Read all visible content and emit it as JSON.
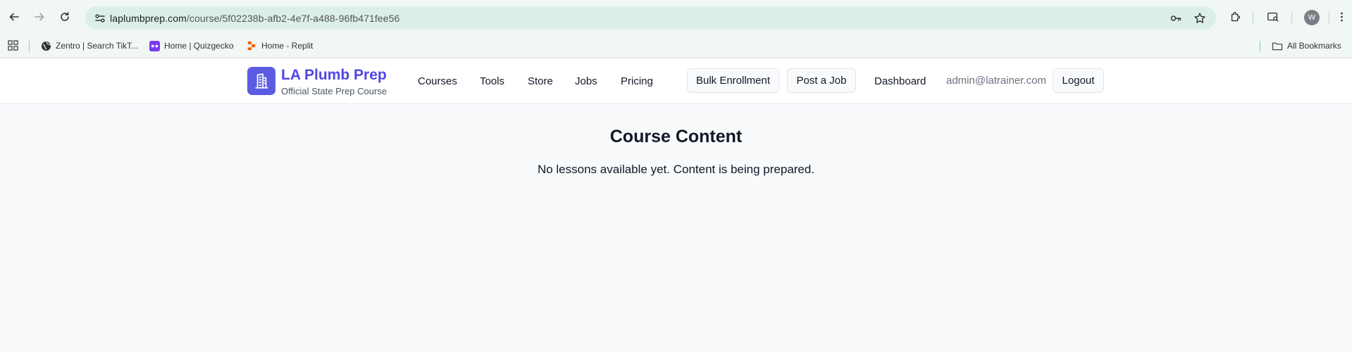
{
  "browser": {
    "url_domain": "laplumbprep.com",
    "url_path": "/course/5f02238b-afb2-4e7f-a488-96fb471fee56",
    "profile_initial": "W",
    "bookmarks": [
      {
        "label": "Zentro | Search TikT...",
        "icon": "globe-icon"
      },
      {
        "label": "Home | Quizgecko",
        "icon": "quizgecko-icon"
      },
      {
        "label": "Home - Replit",
        "icon": "replit-icon"
      }
    ],
    "all_bookmarks_label": "All Bookmarks"
  },
  "site": {
    "brand": "LA Plumb Prep",
    "tagline": "Official State Prep Course",
    "nav": [
      "Courses",
      "Tools",
      "Store",
      "Jobs",
      "Pricing"
    ],
    "bulk_enrollment": "Bulk Enrollment",
    "post_job": "Post a Job",
    "dashboard": "Dashboard",
    "email": "admin@latrainer.com",
    "logout": "Logout"
  },
  "main": {
    "title": "Course Content",
    "message": "No lessons available yet. Content is being prepared."
  },
  "colors": {
    "brand": "#4f46e5",
    "logo_bg": "#5b5ce2",
    "page_bg": "#f8fafc",
    "chrome_bg": "#f0f7f4",
    "omnibox_bg": "#dcefe6"
  }
}
